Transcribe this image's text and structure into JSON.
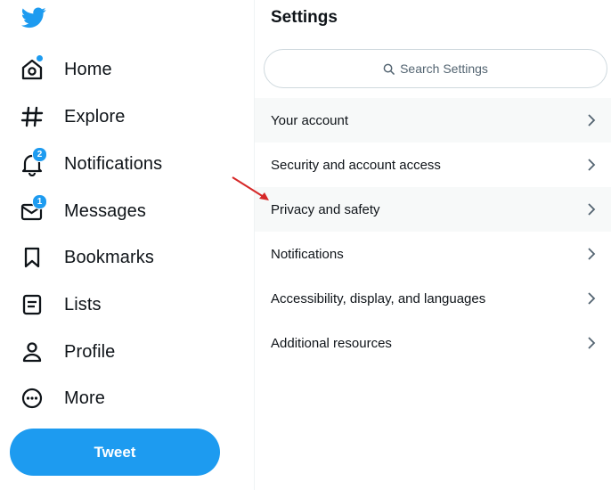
{
  "nav": {
    "items": [
      {
        "label": "Home",
        "icon": "home-icon"
      },
      {
        "label": "Explore",
        "icon": "hashtag-icon"
      },
      {
        "label": "Notifications",
        "icon": "bell-icon",
        "badge": "2"
      },
      {
        "label": "Messages",
        "icon": "envelope-icon",
        "badge": "1"
      },
      {
        "label": "Bookmarks",
        "icon": "bookmark-icon"
      },
      {
        "label": "Lists",
        "icon": "list-icon"
      },
      {
        "label": "Profile",
        "icon": "person-icon"
      },
      {
        "label": "More",
        "icon": "more-circle-icon"
      }
    ],
    "tweet_label": "Tweet"
  },
  "settings": {
    "title": "Settings",
    "search_placeholder": "Search Settings",
    "items": [
      {
        "label": "Your account"
      },
      {
        "label": "Security and account access"
      },
      {
        "label": "Privacy and safety"
      },
      {
        "label": "Notifications"
      },
      {
        "label": "Accessibility, display, and languages"
      },
      {
        "label": "Additional resources"
      }
    ]
  },
  "colors": {
    "accent": "#1d9bf0",
    "annotation_arrow": "#d62828",
    "row_highlight": "#f7f9f9"
  }
}
